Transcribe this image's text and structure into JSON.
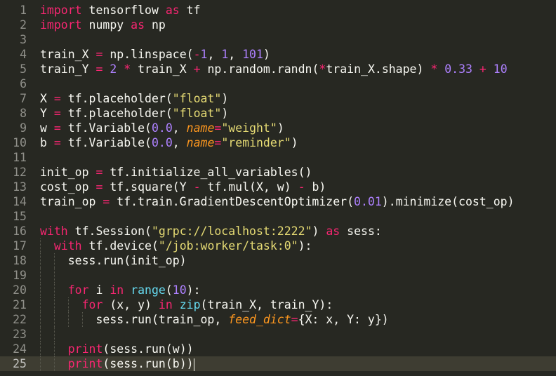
{
  "editor": {
    "theme": "Monokai",
    "active_line": 25,
    "colors": {
      "background": "#272822",
      "active_line": "#3e3d32",
      "keyword": "#f92672",
      "number": "#ae81ff",
      "string": "#e6db74",
      "builtin": "#66d9ef",
      "kwarg": "#fd971f",
      "text": "#f8f8f2",
      "gutter": "#90908a"
    },
    "lines": [
      {
        "n": "1",
        "tokens": [
          [
            "kw",
            "import"
          ],
          [
            "t",
            " tensorflow "
          ],
          [
            "kw",
            "as"
          ],
          [
            "t",
            " tf"
          ]
        ]
      },
      {
        "n": "2",
        "tokens": [
          [
            "kw",
            "import"
          ],
          [
            "t",
            " numpy "
          ],
          [
            "kw",
            "as"
          ],
          [
            "t",
            " np"
          ]
        ]
      },
      {
        "n": "3",
        "tokens": []
      },
      {
        "n": "4",
        "tokens": [
          [
            "t",
            "train_X "
          ],
          [
            "op",
            "="
          ],
          [
            "t",
            " np.linspace("
          ],
          [
            "op",
            "-"
          ],
          [
            "num",
            "1"
          ],
          [
            "t",
            ", "
          ],
          [
            "num",
            "1"
          ],
          [
            "t",
            ", "
          ],
          [
            "num",
            "101"
          ],
          [
            "t",
            ")"
          ]
        ]
      },
      {
        "n": "5",
        "tokens": [
          [
            "t",
            "train_Y "
          ],
          [
            "op",
            "="
          ],
          [
            "t",
            " "
          ],
          [
            "num",
            "2"
          ],
          [
            "t",
            " "
          ],
          [
            "op",
            "*"
          ],
          [
            "t",
            " train_X "
          ],
          [
            "op",
            "+"
          ],
          [
            "t",
            " np.random.randn("
          ],
          [
            "op",
            "*"
          ],
          [
            "t",
            "train_X.shape) "
          ],
          [
            "op",
            "*"
          ],
          [
            "t",
            " "
          ],
          [
            "num",
            "0.33"
          ],
          [
            "t",
            " "
          ],
          [
            "op",
            "+"
          ],
          [
            "t",
            " "
          ],
          [
            "num",
            "10"
          ]
        ]
      },
      {
        "n": "6",
        "tokens": []
      },
      {
        "n": "7",
        "tokens": [
          [
            "t",
            "X "
          ],
          [
            "op",
            "="
          ],
          [
            "t",
            " tf.placeholder("
          ],
          [
            "str",
            "\"float\""
          ],
          [
            "t",
            ")"
          ]
        ]
      },
      {
        "n": "8",
        "tokens": [
          [
            "t",
            "Y "
          ],
          [
            "op",
            "="
          ],
          [
            "t",
            " tf.placeholder("
          ],
          [
            "str",
            "\"float\""
          ],
          [
            "t",
            ")"
          ]
        ]
      },
      {
        "n": "9",
        "tokens": [
          [
            "t",
            "w "
          ],
          [
            "op",
            "="
          ],
          [
            "t",
            " tf.Variable("
          ],
          [
            "num",
            "0.0"
          ],
          [
            "t",
            ", "
          ],
          [
            "kwarg",
            "name"
          ],
          [
            "op",
            "="
          ],
          [
            "str",
            "\"weight\""
          ],
          [
            "t",
            ")"
          ]
        ]
      },
      {
        "n": "10",
        "tokens": [
          [
            "t",
            "b "
          ],
          [
            "op",
            "="
          ],
          [
            "t",
            " tf.Variable("
          ],
          [
            "num",
            "0.0"
          ],
          [
            "t",
            ", "
          ],
          [
            "kwarg",
            "name"
          ],
          [
            "op",
            "="
          ],
          [
            "str",
            "\"reminder\""
          ],
          [
            "t",
            ")"
          ]
        ]
      },
      {
        "n": "11",
        "tokens": []
      },
      {
        "n": "12",
        "tokens": [
          [
            "t",
            "init_op "
          ],
          [
            "op",
            "="
          ],
          [
            "t",
            " tf.initialize_all_variables()"
          ]
        ]
      },
      {
        "n": "13",
        "tokens": [
          [
            "t",
            "cost_op "
          ],
          [
            "op",
            "="
          ],
          [
            "t",
            " tf.square(Y "
          ],
          [
            "op",
            "-"
          ],
          [
            "t",
            " tf.mul(X, w) "
          ],
          [
            "op",
            "-"
          ],
          [
            "t",
            " b)"
          ]
        ]
      },
      {
        "n": "14",
        "tokens": [
          [
            "t",
            "train_op "
          ],
          [
            "op",
            "="
          ],
          [
            "t",
            " tf.train.GradientDescentOptimizer("
          ],
          [
            "num",
            "0.01"
          ],
          [
            "t",
            ").minimize(cost_op)"
          ]
        ]
      },
      {
        "n": "15",
        "tokens": []
      },
      {
        "n": "16",
        "tokens": [
          [
            "kw",
            "with"
          ],
          [
            "t",
            " tf.Session("
          ],
          [
            "str",
            "\"grpc://localhost:2222\""
          ],
          [
            "t",
            ") "
          ],
          [
            "kw",
            "as"
          ],
          [
            "t",
            " sess:"
          ]
        ]
      },
      {
        "n": "17",
        "tokens": [
          [
            "t",
            "  "
          ],
          [
            "kw",
            "with"
          ],
          [
            "t",
            " tf.device("
          ],
          [
            "str",
            "\"/job:worker/task:0\""
          ],
          [
            "t",
            "):"
          ]
        ]
      },
      {
        "n": "18",
        "tokens": [
          [
            "t",
            "    sess.run(init_op)"
          ]
        ]
      },
      {
        "n": "19",
        "tokens": []
      },
      {
        "n": "20",
        "tokens": [
          [
            "t",
            "    "
          ],
          [
            "kw",
            "for"
          ],
          [
            "t",
            " i "
          ],
          [
            "kw",
            "in"
          ],
          [
            "t",
            " "
          ],
          [
            "bi",
            "range"
          ],
          [
            "t",
            "("
          ],
          [
            "num",
            "10"
          ],
          [
            "t",
            "):"
          ]
        ]
      },
      {
        "n": "21",
        "tokens": [
          [
            "t",
            "      "
          ],
          [
            "kw",
            "for"
          ],
          [
            "t",
            " (x, y) "
          ],
          [
            "kw",
            "in"
          ],
          [
            "t",
            " "
          ],
          [
            "bi",
            "zip"
          ],
          [
            "t",
            "(train_X, train_Y):"
          ]
        ]
      },
      {
        "n": "22",
        "tokens": [
          [
            "t",
            "        sess.run(train_op, "
          ],
          [
            "kwarg",
            "feed_dict"
          ],
          [
            "op",
            "="
          ],
          [
            "t",
            "{X: x, Y: y})"
          ]
        ]
      },
      {
        "n": "23",
        "tokens": []
      },
      {
        "n": "24",
        "tokens": [
          [
            "t",
            "    "
          ],
          [
            "kw",
            "print"
          ],
          [
            "t",
            "(sess.run(w))"
          ]
        ]
      },
      {
        "n": "25",
        "tokens": [
          [
            "t",
            "    "
          ],
          [
            "kw",
            "print"
          ],
          [
            "t",
            "(sess.run(b))"
          ]
        ]
      }
    ]
  }
}
